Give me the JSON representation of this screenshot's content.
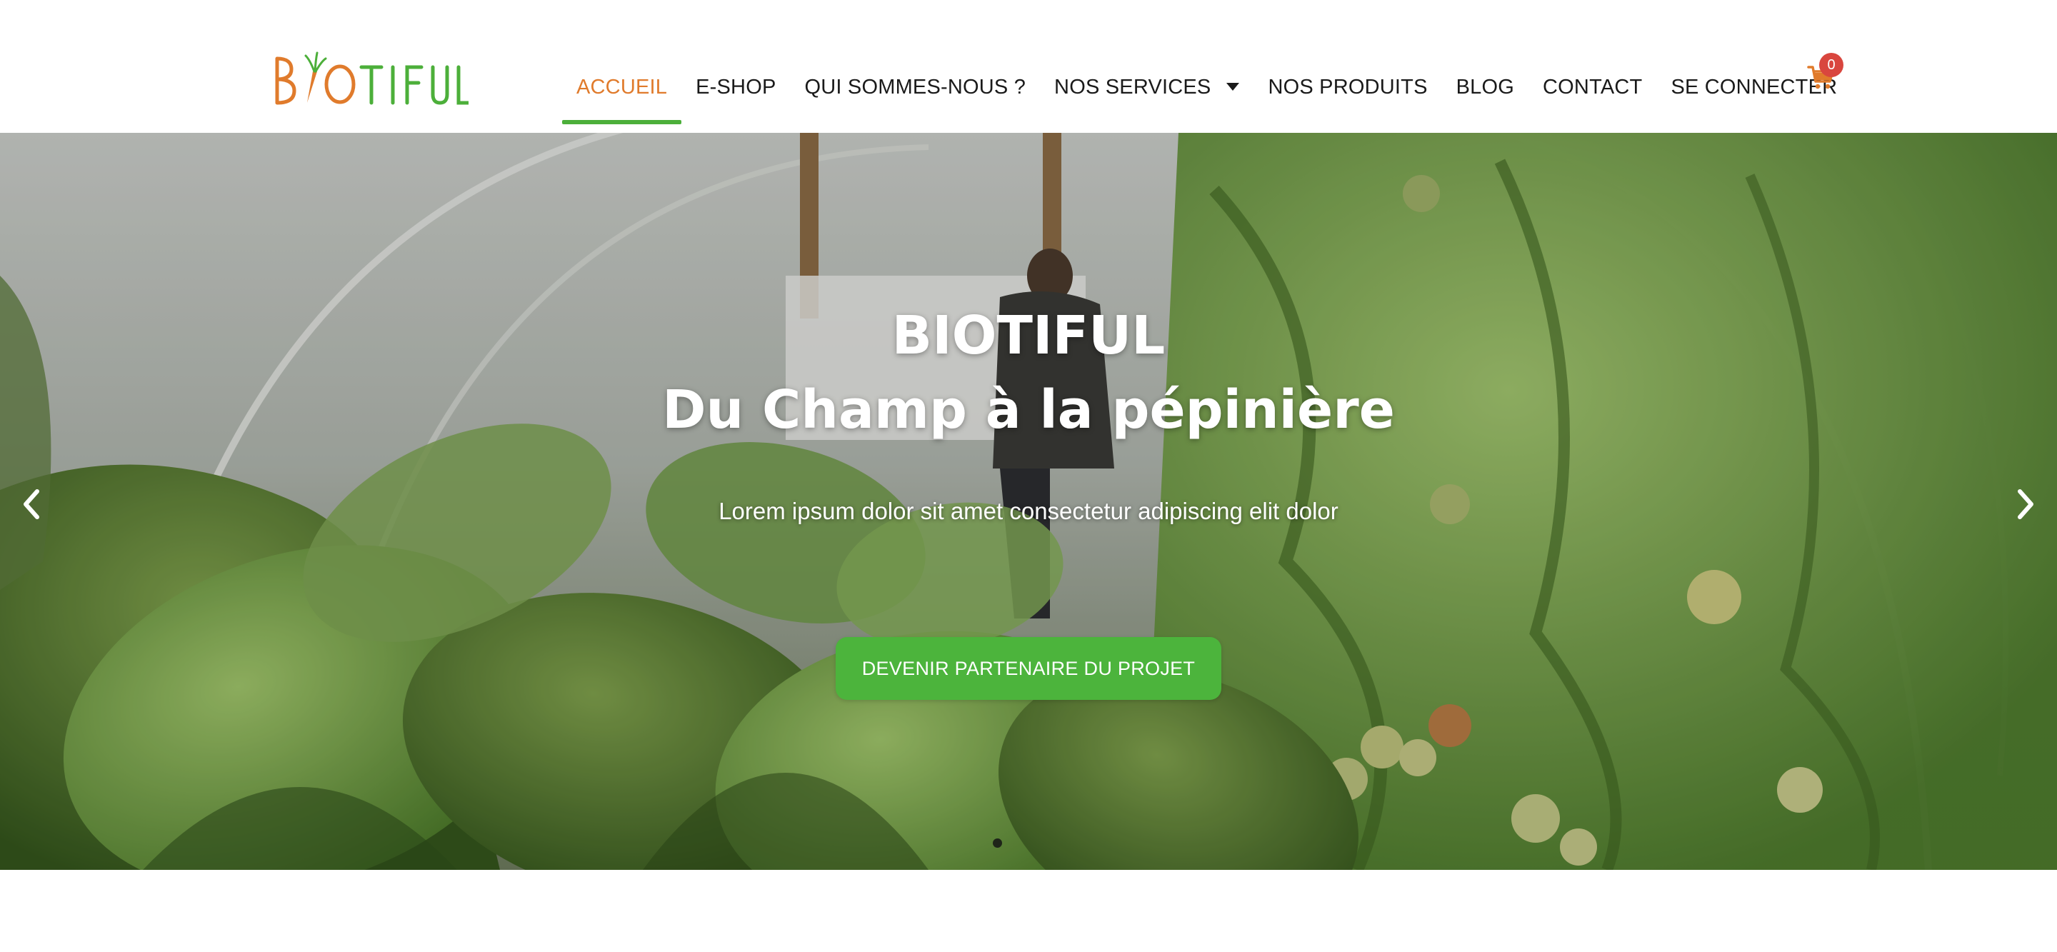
{
  "brand": {
    "logo_text": "BIOTIFUL",
    "logo_orange": "#e07b2c",
    "logo_green": "#4caf3a"
  },
  "nav": {
    "items": [
      {
        "label": "ACCUEIL",
        "active": true
      },
      {
        "label": "E-SHOP",
        "active": false
      },
      {
        "label": "QUI SOMMES-NOUS ?",
        "active": false
      },
      {
        "label": "NOS SERVICES",
        "active": false,
        "dropdown": true
      },
      {
        "label": "NOS PRODUITS",
        "active": false
      },
      {
        "label": "BLOG",
        "active": false
      },
      {
        "label": "CONTACT",
        "active": false
      },
      {
        "label": "SE CONNECTER",
        "active": false
      }
    ],
    "active_color": "#e07b2c",
    "underline_color": "#4caf3a"
  },
  "cart": {
    "icon": "cart-icon",
    "count": "0",
    "badge_color": "#d9463e",
    "icon_color": "#e07b2c"
  },
  "hero": {
    "title": "BIOTIFUL",
    "subtitle": "Du Champ à la pépinière",
    "text": "Lorem ipsum dolor sit amet consectetur adipiscing elit dolor",
    "button_label": "DEVENIR PARTENAIRE DU PROJET",
    "button_color": "#4cb43c",
    "prev_icon": "chevron-left-icon",
    "next_icon": "chevron-right-icon",
    "slides": 1
  }
}
